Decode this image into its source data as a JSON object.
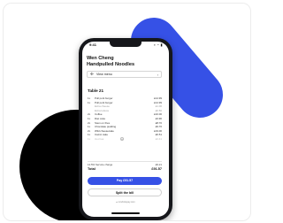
{
  "colors": {
    "accent_blue": "#3651e6",
    "circle_black": "#000000",
    "phone_frame": "#16171b"
  },
  "status_bar": {
    "time": "9:41",
    "icons": "▪ ◔ ▮"
  },
  "restaurant": {
    "name_line1": "Wen Cheng",
    "name_line2": "Handpulled Noodles"
  },
  "menu_button": {
    "icon": "fork-knife-icon",
    "label": "View menu",
    "chevron": "›"
  },
  "table_title": "Table 21",
  "items": [
    {
      "qty": "1x",
      "name": "Pull pork burger",
      "price": "£14.99"
    },
    {
      "qty": "1x",
      "name": "Pull pork burger",
      "price": "£14.99"
    },
    {
      "qty": "",
      "name": "Extra cheese",
      "price": "£1.00"
    },
    {
      "qty": "",
      "name": "Extra lettuce",
      "price": "£0.50"
    },
    {
      "qty": "2x",
      "name": "Coffee",
      "price": "£10.00"
    },
    {
      "qty": "1x",
      "name": "Diet coke",
      "price": "£3.90"
    },
    {
      "qty": "2x",
      "name": "Stem on fries",
      "price": "£8.70"
    },
    {
      "qty": "1x",
      "name": "Chocolate pudding",
      "price": "£9.70"
    },
    {
      "qty": "2x",
      "name": "Wild cheesecake",
      "price": "£19.00"
    },
    {
      "qty": "1x",
      "name": "Carrot cake",
      "price": "£6.51"
    },
    {
      "qty": "1x",
      "name": "Iced tea",
      "price": "£2.41",
      "toggle": "+"
    }
  ],
  "service_charge": {
    "label": "12.5% Service charge",
    "amount": "£9.21"
  },
  "total": {
    "label": "Total",
    "amount": "£91.57"
  },
  "pay_button": "Pay £91.57",
  "split_button": "Split the bill",
  "footer": "● mrwholepay.com"
}
